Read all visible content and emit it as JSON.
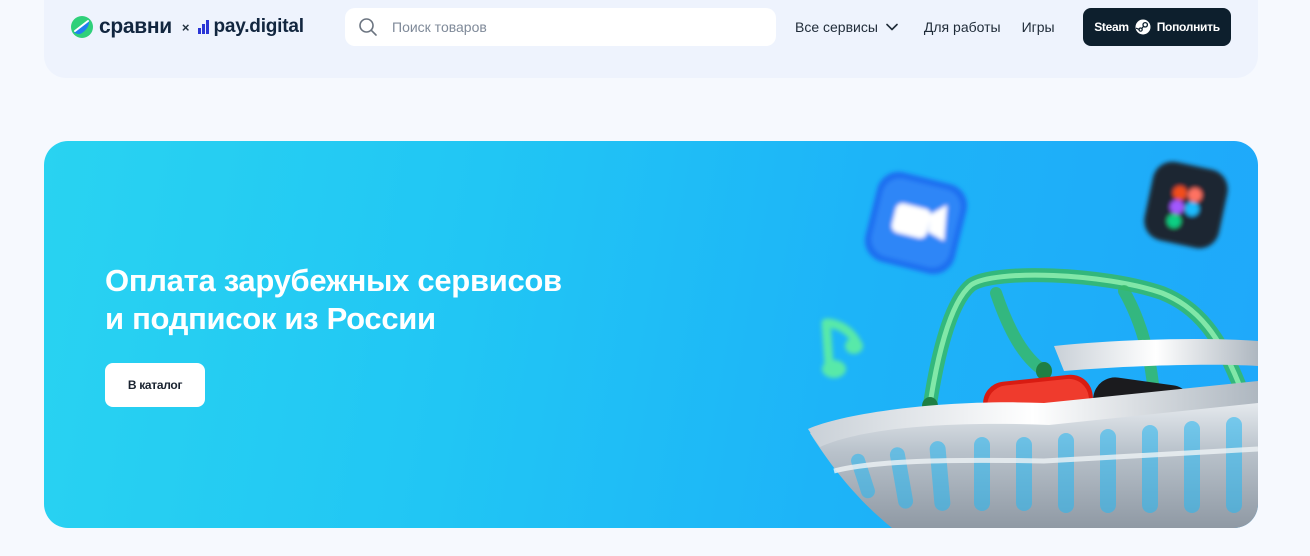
{
  "header": {
    "logo_sravni": "сравни",
    "logo_times": "×",
    "logo_pay": "pay.digital",
    "search": {
      "placeholder": "Поиск товаров",
      "value": ""
    },
    "nav": [
      {
        "label": "Все сервисы",
        "icon": "chevron-down-icon"
      },
      {
        "label": "Для работы"
      },
      {
        "label": "Игры"
      }
    ],
    "steam_button": {
      "brand": "Steam",
      "icon": "steam-icon",
      "action": "Пополнить"
    }
  },
  "hero": {
    "title_line1": "Оплата зарубежных сервисов",
    "title_line2": "и подписок из России",
    "catalog_button": "В каталог",
    "illustration_items": [
      "video-camera-app-icon",
      "figma-app-icon",
      "music-note-icon",
      "shopping-basket",
      "youtube-app-icon",
      "netflix-app-icon"
    ]
  },
  "colors": {
    "page_bg": "#f6f9fe",
    "header_bg": "#eef3fd",
    "steam_button_bg": "#0d1f2d",
    "banner_gradient_start": "#29d3f1",
    "banner_gradient_end": "#1fa8fa",
    "logo_accent_green": "#2fd07a",
    "logo_accent_blue": "#2a35d6"
  }
}
